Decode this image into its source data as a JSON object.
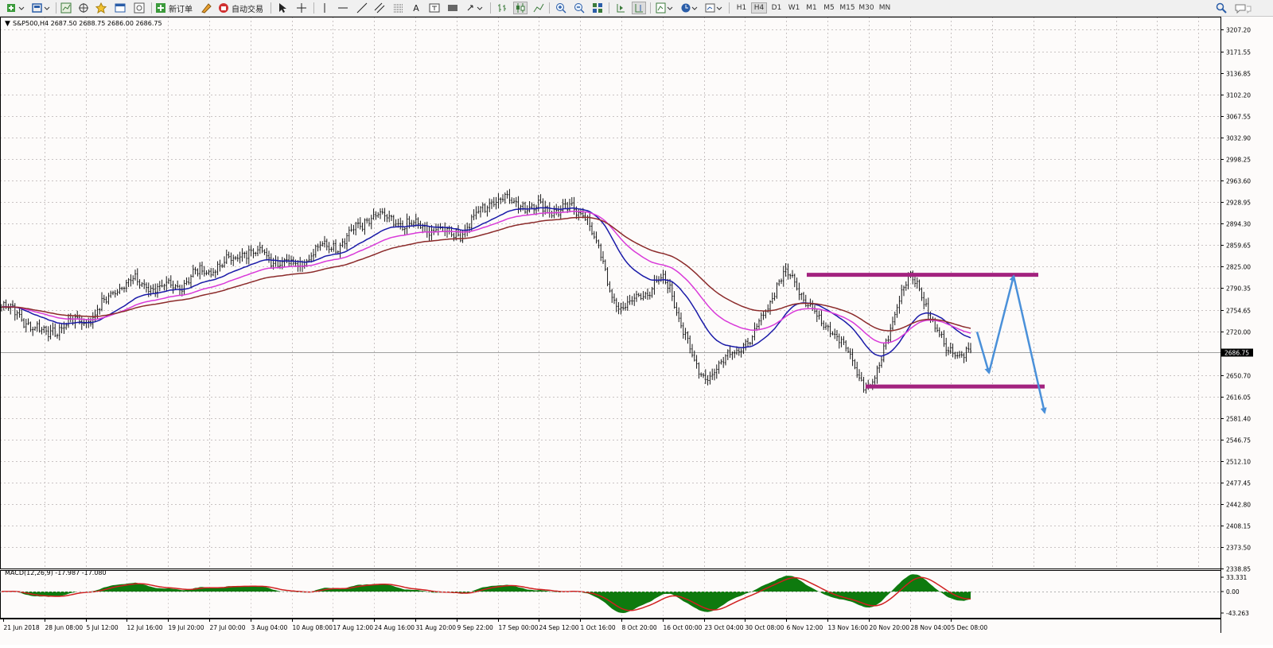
{
  "toolbar": {
    "new_order_label": "新订单",
    "auto_trade_label": "自动交易",
    "timeframes": [
      "H1",
      "H4",
      "D1",
      "W1",
      "M1",
      "M5",
      "M15",
      "M30",
      "MN"
    ],
    "active_timeframe": "H4",
    "tool_a_label": "A"
  },
  "chart": {
    "symbol_header": "S&P500,H4  2687.50 2688.75 2686.00 2686.75",
    "current_price": "2686.75",
    "price_axis_labels": [
      "3207.20",
      "3171.55",
      "3136.85",
      "3102.20",
      "3067.55",
      "3032.90",
      "2998.25",
      "2963.60",
      "2928.95",
      "2894.30",
      "2859.65",
      "2825.00",
      "2790.35",
      "2754.65",
      "2720.00",
      "2650.70",
      "2616.05",
      "2581.40",
      "2546.75",
      "2512.10",
      "2477.45",
      "2442.80",
      "2408.15",
      "2373.50",
      "2338.85"
    ],
    "time_axis_labels": [
      "21 Jun 2018",
      "28 Jun 08:00",
      "5 Jul 12:00",
      "12 Jul 16:00",
      "19 Jul 20:00",
      "27 Jul 00:00",
      "3 Aug 04:00",
      "10 Aug 08:00",
      "17 Aug 12:00",
      "24 Aug 16:00",
      "31 Aug 20:00",
      "9 Sep 22:00",
      "17 Sep 00:00",
      "24 Sep 12:00",
      "1 Oct 16:00",
      "8 Oct 20:00",
      "16 Oct 00:00",
      "23 Oct 04:00",
      "30 Oct 08:00",
      "6 Nov 12:00",
      "13 Nov 16:00",
      "20 Nov 20:00",
      "28 Nov 04:00",
      "5 Dec 08:00"
    ]
  },
  "macd": {
    "header": "MACD(12,26,9) -17.987 -17.080",
    "axis_labels": [
      "33.331",
      "0.00",
      "-43.263"
    ]
  },
  "colors": {
    "resistance_line": "#a3237f",
    "support_line": "#a3237f",
    "arrow": "#4a90d9",
    "ma_blue": "#1a1aa8",
    "ma_magenta": "#d93ad9",
    "ma_brown": "#8b2a2a",
    "macd_histogram": "#0e7a0e",
    "macd_signal": "#d02020"
  },
  "chart_data": {
    "type": "line",
    "series": [
      {
        "name": "S&P500,H4",
        "x": [
          "21 Jun 2018",
          "28 Jun 08:00",
          "5 Jul 12:00",
          "12 Jul 16:00",
          "19 Jul 20:00",
          "27 Jul 00:00",
          "3 Aug 04:00",
          "10 Aug 08:00",
          "17 Aug 12:00",
          "24 Aug 16:00",
          "31 Aug 20:00",
          "9 Sep 22:00",
          "17 Sep 00:00",
          "24 Sep 12:00",
          "1 Oct 16:00",
          "8 Oct 20:00",
          "16 Oct 00:00",
          "23 Oct 04:00",
          "30 Oct 08:00",
          "6 Nov 12:00",
          "13 Nov 16:00",
          "20 Nov 20:00",
          "28 Nov 04:00",
          "5 Dec 08:00"
        ],
        "values": [
          2760,
          2720,
          2740,
          2800,
          2790,
          2820,
          2850,
          2830,
          2860,
          2905,
          2890,
          2880,
          2935,
          2920,
          2915,
          2760,
          2800,
          2650,
          2700,
          2810,
          2730,
          2635,
          2805,
          2686.75
        ]
      }
    ],
    "ylim": [
      2338.85,
      3207.2
    ],
    "support_level": 2632,
    "resistance_level": 2812,
    "grid": true
  }
}
